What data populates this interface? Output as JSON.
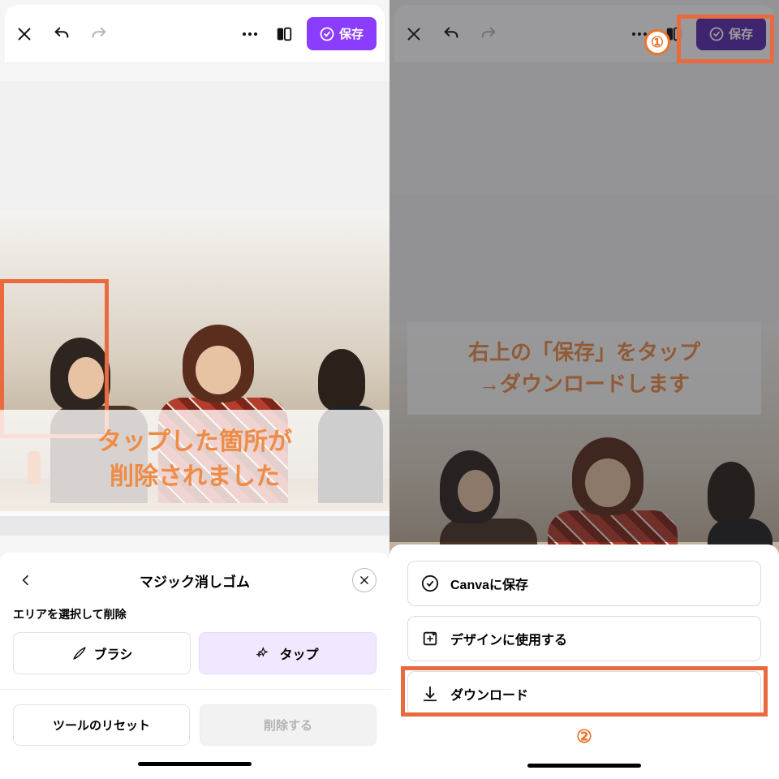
{
  "toolbar": {
    "save_label": "保存"
  },
  "left": {
    "caption_line1": "タップした箇所が",
    "caption_line2": "削除されました",
    "panel_title": "マジック消しゴム",
    "section_label": "エリアを選択して削除",
    "brush_label": "ブラシ",
    "tap_label": "タップ",
    "reset_label": "ツールのリセット",
    "delete_label": "削除する"
  },
  "right": {
    "caption_line1": "右上の「保存」をタップ",
    "caption_line2": "→ダウンロードします",
    "badge1": "①",
    "badge2": "②",
    "sheet": {
      "save_canva": "Canvaに保存",
      "use_in_design": "デザインに使用する",
      "download": "ダウンロード"
    }
  }
}
